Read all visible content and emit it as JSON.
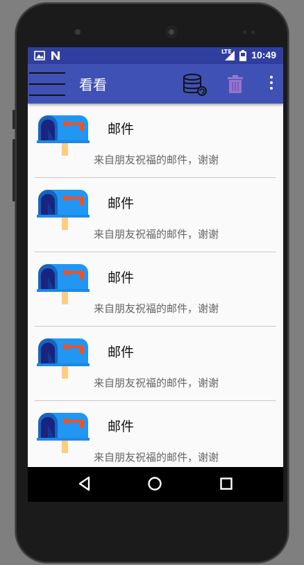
{
  "status_bar": {
    "time": "10:49",
    "network": "LTE"
  },
  "toolbar": {
    "title": "看看",
    "menu_icon": "hamburger-icon",
    "sync_icon": "database-sync-icon",
    "delete_icon": "trash-icon",
    "overflow_icon": "more-vert-icon"
  },
  "items": [
    {
      "title": "邮件",
      "desc": "来自朋友祝福的邮件，谢谢"
    },
    {
      "title": "邮件",
      "desc": "来自朋友祝福的邮件，谢谢"
    },
    {
      "title": "邮件",
      "desc": "来自朋友祝福的邮件，谢谢"
    },
    {
      "title": "邮件",
      "desc": "来自朋友祝福的邮件，谢谢"
    },
    {
      "title": "邮件",
      "desc": "来自朋友祝福的邮件，谢谢"
    }
  ],
  "colors": {
    "status_bar": "#303f9f",
    "toolbar": "#3f51b5",
    "mailbox_blue": "#2196f3",
    "mailbox_dark": "#1a237e",
    "flag_red": "#f4511e",
    "trash": "#9575cd"
  }
}
